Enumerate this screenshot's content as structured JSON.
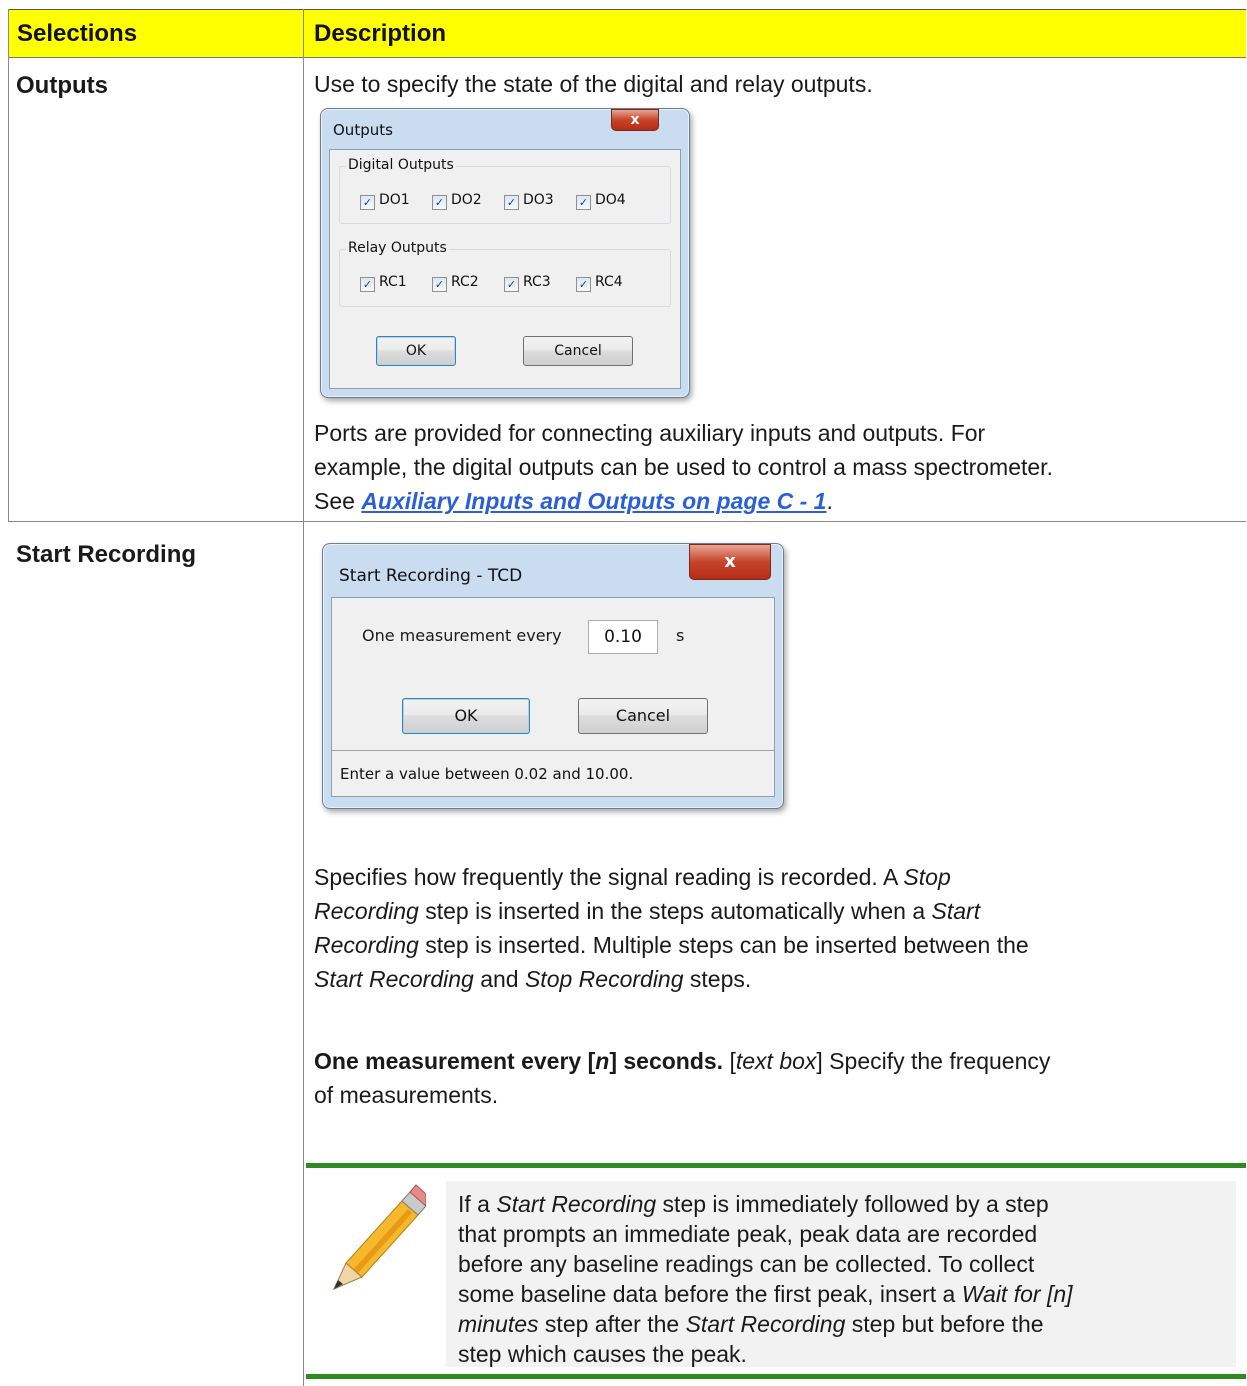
{
  "header": {
    "selections": "Selections",
    "description": "Description"
  },
  "outputs_row": {
    "name": "Outputs",
    "intro": "Use to specify the state of the digital and relay outputs.",
    "dialog": {
      "title": "Outputs",
      "close_label": "x",
      "digital_group": "Digital Outputs",
      "digital": [
        "DO1",
        "DO2",
        "DO3",
        "DO4"
      ],
      "relay_group": "Relay Outputs",
      "relay": [
        "RC1",
        "RC2",
        "RC3",
        "RC4"
      ],
      "checked": "✓",
      "ok": "OK",
      "cancel": "Cancel"
    },
    "para_line1": "Ports are provided for connecting auxiliary inputs and outputs. For",
    "para_line2": "example, the digital outputs can be used to control a mass spectrometer.",
    "para_see": "See ",
    "para_link": "Auxiliary Inputs and Outputs on page C - 1",
    "para_end": "."
  },
  "recording_row": {
    "name": "Start Recording",
    "dialog": {
      "title": "Start Recording - TCD",
      "close_label": "x",
      "field_label": "One measurement every",
      "field_value": "0.10",
      "unit": "s",
      "ok": "OK",
      "cancel": "Cancel",
      "status": "Enter a value between 0.02 and 10.00."
    },
    "desc": {
      "l1a": "Specifies how frequently the signal reading is recorded. A ",
      "l1b": "Stop",
      "l2a": "Recording",
      "l2b": " step is inserted in the steps automatically when a ",
      "l2c": "Start",
      "l3a": "Recording",
      "l3b": " step is inserted. Multiple steps can be inserted between the",
      "l4a": "Start Recording",
      "l4b": " and ",
      "l4c": "Stop Recording",
      "l4d": " steps."
    },
    "measure": {
      "bold1": "One measurement every [",
      "n": "n",
      "bold2": "] seconds.",
      "b1": " [",
      "textbox": "text box",
      "b2": "] Specify the frequency",
      "line2": "of measurements."
    },
    "note": {
      "l1a": "If a ",
      "l1b": "Start Recording",
      "l1c": " step is immediately followed by a step",
      "l2": "that prompts an immediate peak, peak data are recorded",
      "l3": "before any baseline readings can be collected. To collect",
      "l4a": "some baseline data before the first peak, insert a ",
      "l4b": "Wait for [n]",
      "l5a": "minutes",
      "l5b": " step after the ",
      "l5c": "Start Recording",
      "l5d": " step but before the",
      "l6": "step which causes the peak."
    }
  }
}
